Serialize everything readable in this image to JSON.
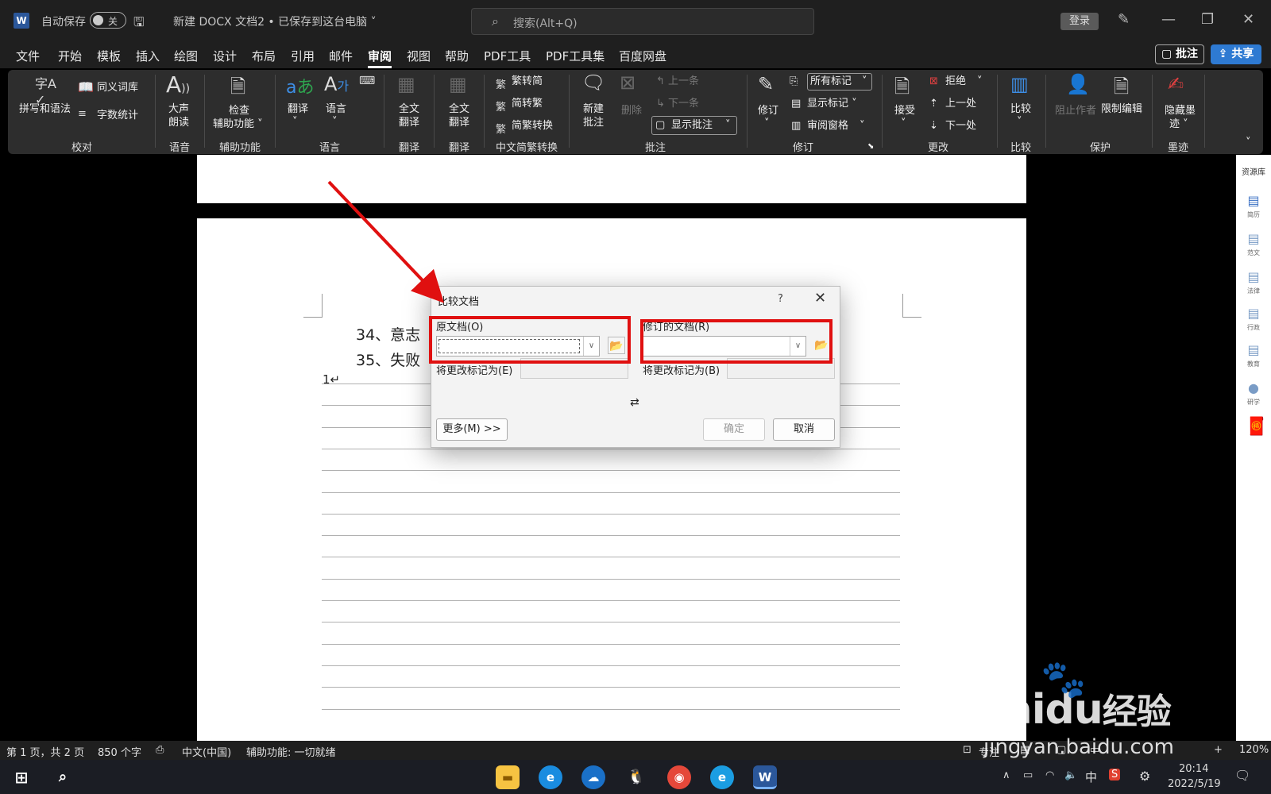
{
  "titlebar": {
    "autosave_label": "自动保存",
    "autosave_state": "关",
    "doc_title": "新建 DOCX 文档2 • 已保存到这台电脑 ˅",
    "search_placeholder": "搜索(Alt+Q)",
    "login_label": "登录"
  },
  "menu": {
    "items": [
      "文件",
      "开始",
      "模板",
      "插入",
      "绘图",
      "设计",
      "布局",
      "引用",
      "邮件",
      "审阅",
      "视图",
      "帮助",
      "PDF工具",
      "PDF工具集",
      "百度网盘"
    ],
    "active": "审阅",
    "comment_btn": "批注",
    "share_btn": "共享"
  },
  "ribbon": {
    "spell": "拼写和语法",
    "thesaurus": "同义词库",
    "wordcount": "字数统计",
    "read_aloud_1": "大声",
    "read_aloud_2": "朗读",
    "check_1": "检查",
    "check_2": "辅助功能 ˅",
    "translate": "翻译",
    "language": "语言",
    "full_translate_1": "全文",
    "full_translate_2": "翻译",
    "trad_to_simp": "繁转简",
    "simp_to_trad": "简转繁",
    "simp_trad_convert": "简繁转换",
    "new_comment_1": "新建",
    "new_comment_2": "批注",
    "delete": "删除",
    "prev_comment": "上一条",
    "next_comment": "下一条",
    "show_comments": "显示批注",
    "track": "修订",
    "all_markup": "所有标记",
    "show_markup": "显示标记 ˅",
    "review_pane": "审阅窗格",
    "accept": "接受",
    "reject": "拒绝",
    "prev_change": "上一处",
    "next_change": "下一处",
    "compare": "比较",
    "block_authors": "阻止作者",
    "restrict_edit": "限制编辑",
    "hide_ink_1": "隐藏墨",
    "hide_ink_2": "迹 ˅",
    "groups": {
      "proofing": "校对",
      "speech": "语音",
      "accessibility": "辅助功能",
      "language": "语言",
      "translate1": "翻译",
      "translate2": "翻译",
      "chinese_convert": "中文简繁转换",
      "comments": "批注",
      "tracking": "修订",
      "changes": "更改",
      "compare": "比较",
      "protect": "保护",
      "ink": "墨迹"
    }
  },
  "document": {
    "line34": "34、意志",
    "line35": "35、失败",
    "page_num": "1↵"
  },
  "dialog": {
    "title": "比较文档",
    "help": "?",
    "original_label": "原文档(O)",
    "revised_label": "修订的文档(R)",
    "label_changes_original": "将更改标记为(E)",
    "label_changes_revised": "将更改标记为(B)",
    "swap": "⇄",
    "more_btn": "更多(M) >>",
    "ok_btn": "确定",
    "cancel_btn": "取消"
  },
  "rightpane": {
    "header": "资源库",
    "items": [
      "简历",
      "范文",
      "法律",
      "行政",
      "教育",
      "研学"
    ]
  },
  "status": {
    "page": "第 1 页，共 2 页",
    "words": "850 个字",
    "lang": "中文(中国)",
    "accessibility": "辅助功能: 一切就绪",
    "focus": "专注",
    "zoom": "120%"
  },
  "taskbar": {
    "time": "20:14",
    "date": "2022/5/19",
    "ime": "中"
  },
  "watermark": {
    "brand": "Baidu",
    "brand_cn": "经验",
    "url": "jingyan.baidu.com"
  },
  "colors": {
    "accent_red": "#e01010",
    "share_blue": "#2e7ad2",
    "word_blue": "#2b579a"
  }
}
